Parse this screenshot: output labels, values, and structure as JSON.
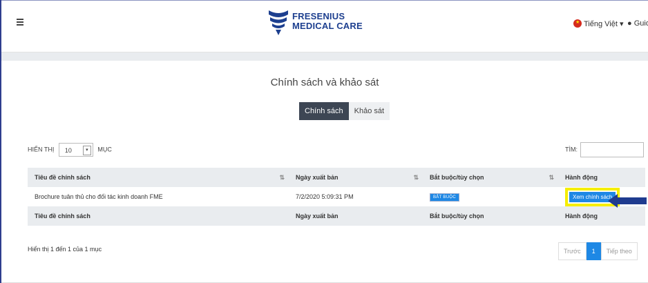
{
  "brand": {
    "name_line1": "FRESENIUS",
    "name_line2": "MEDICAL CARE",
    "color": "#1d3f8f"
  },
  "header": {
    "language": "Tiếng Việt",
    "language_caret": "▾",
    "user_label": "Guide"
  },
  "page": {
    "title": "Chính sách và khảo sát"
  },
  "tabs": [
    {
      "label": "Chính sách",
      "active": true
    },
    {
      "label": "Khảo sát",
      "active": false
    }
  ],
  "length_control": {
    "prefix": "HIỂN THỊ",
    "value": "10",
    "suffix": "MỤC"
  },
  "search": {
    "label": "TÌM:",
    "value": ""
  },
  "table": {
    "columns": [
      "Tiêu đề chính sách",
      "Ngày xuất bản",
      "Bắt buộc/tùy chọn",
      "Hành động"
    ],
    "rows": [
      {
        "title": "Brochure tuân thủ cho đối tác kinh doanh FME",
        "date": "7/2/2020 5:09:31 PM",
        "badge": "BẮT BUỘC",
        "action": "Xem chính sách"
      }
    ],
    "footer": [
      "Tiêu đề chính sách",
      "Ngày xuất bản",
      "Bắt buộc/tùy chọn",
      "Hành động"
    ]
  },
  "info": "Hiển thị 1 đến 1 của 1 mục",
  "pagination": {
    "prev": "Trước",
    "current": "1",
    "next": "Tiếp theo"
  },
  "colors": {
    "accent": "#1e88e5",
    "highlight": "#f5ee00",
    "arrow": "#1f3b8f",
    "tab_active": "#3d4654"
  }
}
